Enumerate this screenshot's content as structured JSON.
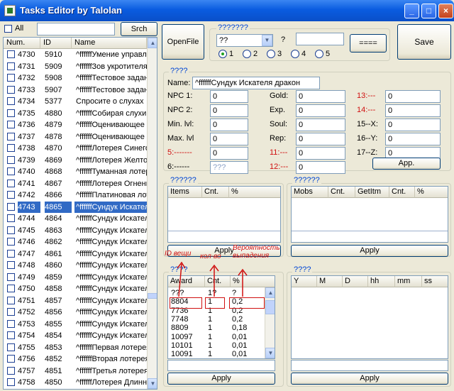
{
  "window": {
    "title": "Tasks Editor by Talolan",
    "minimize": "_",
    "maximize": "□",
    "close": "×"
  },
  "search": {
    "all_label": "All",
    "value": "",
    "button": "Srch"
  },
  "list": {
    "headers": [
      "Num.",
      "ID",
      "Name"
    ],
    "rows": [
      [
        "4730",
        "5910",
        "^ffffffУмение управл"
      ],
      [
        "4731",
        "5909",
        "^ffffffЗов укротителя"
      ],
      [
        "4732",
        "5908",
        "^ffffffТестовое задан"
      ],
      [
        "4733",
        "5907",
        "^ffffffТестовое задан"
      ],
      [
        "4734",
        "5377",
        "Спросите о слухах"
      ],
      [
        "4735",
        "4880",
        "^ffffffСобирая слухи"
      ],
      [
        "4736",
        "4879",
        "^ffffffОценивающее и"
      ],
      [
        "4737",
        "4878",
        "^ffffffОценивающее и"
      ],
      [
        "4738",
        "4870",
        "^ffffffЛотерея Синего"
      ],
      [
        "4739",
        "4869",
        "^ffffffЛотерея Желтог"
      ],
      [
        "4740",
        "4868",
        "^ffffffТуманная лотер"
      ],
      [
        "4741",
        "4867",
        "^ffffffЛотерея Огненн"
      ],
      [
        "4742",
        "4866",
        "^ffffffПлатиновая лот"
      ],
      [
        "4743",
        "4865",
        "^ffffffСундук Искател"
      ],
      [
        "4744",
        "4864",
        "^ffffffСундук Искател"
      ],
      [
        "4745",
        "4863",
        "^ffffffСундук Искател"
      ],
      [
        "4746",
        "4862",
        "^ffffffСундук Искател"
      ],
      [
        "4747",
        "4861",
        "^ffffffСундук Искател"
      ],
      [
        "4748",
        "4860",
        "^ffffffСундук Искател"
      ],
      [
        "4749",
        "4859",
        "^ffffffСундук Искател"
      ],
      [
        "4750",
        "4858",
        "^ffffffСундук Искател"
      ],
      [
        "4751",
        "4857",
        "^ffffffСундук Искател"
      ],
      [
        "4752",
        "4856",
        "^ffffffСундук Искател"
      ],
      [
        "4753",
        "4855",
        "^ffffffСундук Искател"
      ],
      [
        "4754",
        "4854",
        "^ffffffСундук Искател"
      ],
      [
        "4755",
        "4853",
        "^ffffffПервая лотерея"
      ],
      [
        "4756",
        "4852",
        "^ffffffВторая лотерея"
      ],
      [
        "4757",
        "4851",
        "^ffffffТретья лотерея"
      ],
      [
        "4758",
        "4850",
        "^ffffffЛотерея Длинн"
      ]
    ],
    "selected_index": 13
  },
  "top": {
    "openfile": "OpenFile",
    "group_label": "???????",
    "combo_value": "??",
    "combo_arrow": "▼",
    "q_label": "?",
    "q_value": "",
    "eq_button": "====",
    "save": "Save",
    "radios": [
      "1",
      "2",
      "3",
      "4",
      "5"
    ],
    "radio_selected": 0
  },
  "quest": {
    "group_label": "????",
    "name_label": "Name:",
    "name_value": "^ffffffСундук Искателя дракон",
    "col1": [
      {
        "label": "NPC 1:",
        "value": "0",
        "red": false
      },
      {
        "label": "NPC 2:",
        "value": "0",
        "red": false
      },
      {
        "label": "Min. lvl:",
        "value": "0",
        "red": false
      },
      {
        "label": "Max. lvl",
        "value": "0",
        "red": false
      },
      {
        "label": "5:-------",
        "value": "0",
        "red": true
      },
      {
        "label": "6:------",
        "value": "???",
        "red": false
      }
    ],
    "col2": [
      {
        "label": "Gold:",
        "value": "0",
        "red": false
      },
      {
        "label": "Exp.",
        "value": "0",
        "red": false
      },
      {
        "label": "Soul:",
        "value": "0",
        "red": false
      },
      {
        "label": "Rep:",
        "value": "0",
        "red": false
      },
      {
        "label": "11:---",
        "value": "0",
        "red": true
      },
      {
        "label": "12:---",
        "value": "0",
        "red": true
      }
    ],
    "col3": [
      {
        "label": "13:---",
        "value": "0",
        "red": true
      },
      {
        "label": "14:---",
        "value": "0",
        "red": true
      },
      {
        "label": "15--X:",
        "value": "0",
        "red": false
      },
      {
        "label": "16--Y:",
        "value": "0",
        "red": false
      },
      {
        "label": "17--Z:",
        "value": "0",
        "red": false
      }
    ],
    "app_button": "App."
  },
  "items_group": {
    "label": "??????",
    "headers": [
      "Items",
      "Cnt.",
      "%"
    ],
    "apply": "Apply"
  },
  "mobs_group": {
    "label": "??????",
    "headers": [
      "Mobs",
      "Cnt.",
      "GetItm",
      "Cnt.",
      "%"
    ],
    "apply": "Apply"
  },
  "award_group": {
    "label": "????",
    "headers": [
      "Award",
      "Cnt.",
      "%"
    ],
    "rows": [
      [
        "???",
        "1?",
        "?"
      ],
      [
        "8804",
        "1",
        "0,2"
      ],
      [
        "7736",
        "1",
        "0,2"
      ],
      [
        "7748",
        "1",
        "0,2"
      ],
      [
        "8809",
        "1",
        "0,18"
      ],
      [
        "10097",
        "1",
        "0,01"
      ],
      [
        "10101",
        "1",
        "0,01"
      ],
      [
        "10091",
        "1",
        "0,01"
      ]
    ],
    "apply": "Apply"
  },
  "time_group": {
    "label": "????",
    "headers": [
      "Y",
      "M",
      "D",
      "hh",
      "mm",
      "ss"
    ],
    "apply": "Apply"
  },
  "annotations": {
    "id": "ID вещи",
    "count": "кол-во",
    "chance": "Вероятность выпадения"
  },
  "colors": {
    "title_bar": "#0a5ce0",
    "selection": "#316ac5",
    "annotation": "#d01010",
    "group_label": "#0046d5"
  }
}
